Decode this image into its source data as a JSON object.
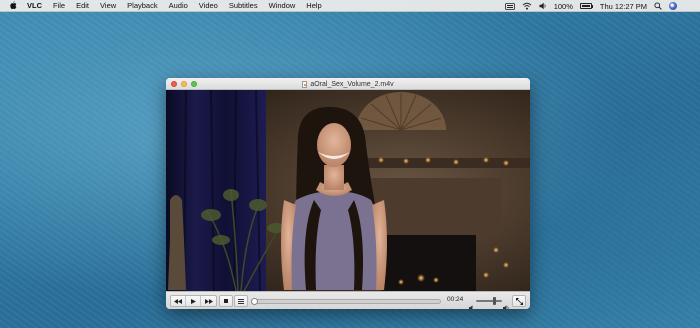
{
  "menubar": {
    "apple_icon": "apple-icon",
    "items": [
      "VLC",
      "File",
      "Edit",
      "View",
      "Playback",
      "Audio",
      "Video",
      "Subtitles",
      "Window",
      "Help"
    ],
    "status": {
      "battery_percent": "100%",
      "clock": "Thu 12:27 PM"
    }
  },
  "window": {
    "title": "aOral_Sex_Volume_2.m4v",
    "controls": {
      "rewind_icon": "rewind-icon",
      "play_icon": "play-icon",
      "forward_icon": "fast-forward-icon",
      "stop_icon": "stop-icon",
      "playlist_icon": "playlist-icon",
      "time": "00:24",
      "fullscreen_icon": "fullscreen-icon"
    }
  },
  "colors": {
    "desktop": "#2f7aa3",
    "close": "#ee5e55",
    "minimize": "#f5bd4f",
    "maximize": "#5fc454"
  }
}
